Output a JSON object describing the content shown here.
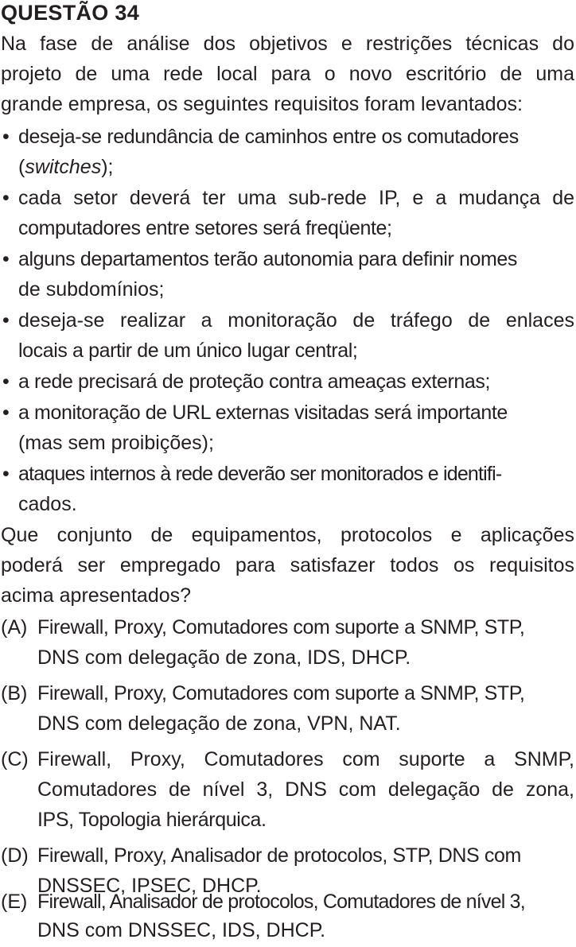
{
  "question": {
    "title": "QUESTÃO 34",
    "intro_lines": [
      "Na fase de análise dos objetivos e restrições técnicas do",
      "projeto de uma rede local para o novo escritório de uma",
      "grande empresa, os seguintes requisitos foram levantados:"
    ],
    "bullet_symbol": "•",
    "requirements": [
      {
        "line1": "deseja-se redundância de caminhos entre os comutadores",
        "line2_pre": "(",
        "line2_em": "switches",
        "line2_post": ");"
      },
      {
        "line1": "cada setor deverá ter uma sub-rede IP, e a mudança de",
        "line2": "computadores entre setores será freqüente;"
      },
      {
        "line1": "alguns departamentos terão autonomia para definir nomes",
        "line2": "de subdomínios;"
      },
      {
        "line1": "deseja-se realizar a monitoração de tráfego de enlaces",
        "line2": "locais a partir de um único lugar central;"
      },
      {
        "line1": "a rede precisará de proteção contra ameaças externas;"
      },
      {
        "line1": "a monitoração de URL externas visitadas será importante",
        "line2": "(mas sem proibições);"
      },
      {
        "line1": "ataques internos à rede deverão ser monitorados e identifi-",
        "line2": "cados."
      }
    ],
    "prompt_lines": [
      "Que conjunto de equipamentos, protocolos e aplicações",
      "poderá ser empregado para satisfazer todos os requisitos",
      "acima apresentados?"
    ],
    "options": [
      {
        "letter": "(A)",
        "lines": [
          "Firewall, Proxy, Comutadores com suporte a SNMP, STP,",
          "DNS com delegação de zona, IDS, DHCP."
        ]
      },
      {
        "letter": "(B)",
        "lines": [
          "Firewall, Proxy, Comutadores com suporte a SNMP, STP,",
          "DNS com delegação de zona, VPN, NAT."
        ]
      },
      {
        "letter": "(C)",
        "lines": [
          "Firewall, Proxy, Comutadores com suporte a SNMP,",
          "Comutadores de nível 3, DNS com delegação de zona,",
          "IPS, Topologia hierárquica."
        ]
      },
      {
        "letter": "(D)",
        "lines": [
          "Firewall, Proxy, Analisador de protocolos, STP, DNS com",
          "DNSSEC, IPSEC, DHCP."
        ]
      },
      {
        "letter": "(E)",
        "lines": [
          "Firewall, Analisador de protocolos, Comutadores de nível 3,",
          "DNS com DNSSEC, IDS, DHCP."
        ]
      }
    ]
  }
}
